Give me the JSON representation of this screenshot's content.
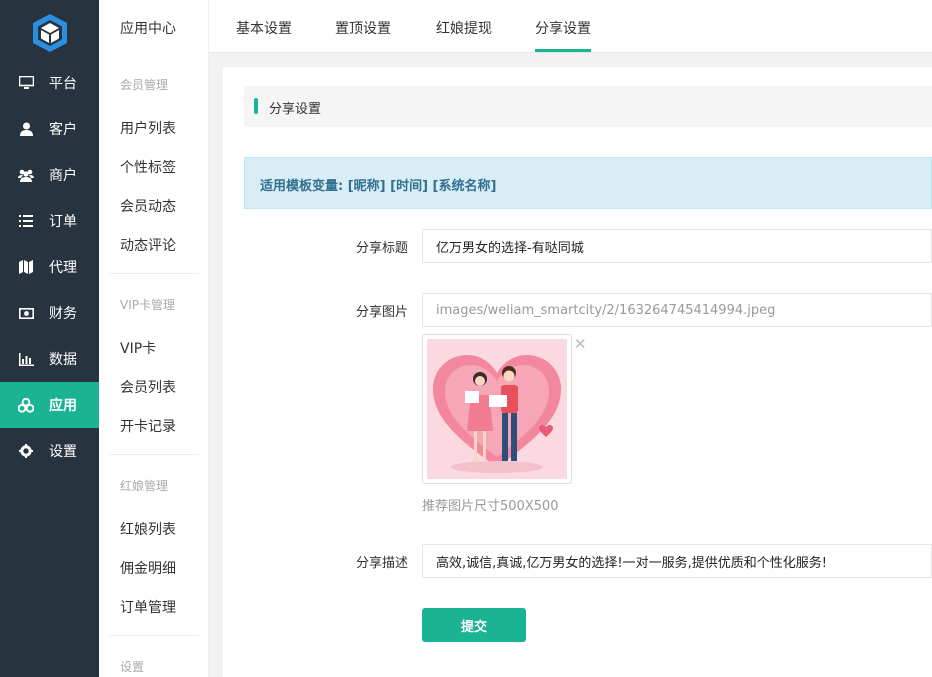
{
  "sidebar": {
    "logo": "app-logo",
    "items": [
      {
        "label": "平台",
        "icon": "monitor-icon"
      },
      {
        "label": "客户",
        "icon": "user-icon"
      },
      {
        "label": "商户",
        "icon": "users-icon"
      },
      {
        "label": "订单",
        "icon": "list-icon"
      },
      {
        "label": "代理",
        "icon": "map-icon"
      },
      {
        "label": "财务",
        "icon": "money-icon"
      },
      {
        "label": "数据",
        "icon": "bar-chart-icon"
      },
      {
        "label": "应用",
        "icon": "cubes-icon",
        "active": true
      },
      {
        "label": "设置",
        "icon": "gear-icon"
      }
    ]
  },
  "subnav": {
    "title": "应用中心",
    "groups": [
      {
        "title": "会员管理",
        "items": [
          "用户列表",
          "个性标签",
          "会员动态",
          "动态评论"
        ]
      },
      {
        "title": "VIP卡管理",
        "items": [
          "VIP卡",
          "会员列表",
          "开卡记录"
        ]
      },
      {
        "title": "红娘管理",
        "items": [
          "红娘列表",
          "佣金明细",
          "订单管理"
        ]
      },
      {
        "title": "设置",
        "items": []
      }
    ]
  },
  "tabs": [
    {
      "label": "基本设置"
    },
    {
      "label": "置顶设置"
    },
    {
      "label": "红娘提现"
    },
    {
      "label": "分享设置",
      "active": true
    }
  ],
  "main": {
    "section_title": "分享设置",
    "notice": "适用模板变量: [昵称] [时间] [系统名称]",
    "fields": {
      "title_label": "分享标题",
      "title_value": "亿万男女的选择-有哒同城",
      "image_label": "分享图片",
      "image_value": "images/weliam_smartcity/2/163264745414994.jpeg",
      "image_hint": "推荐图片尺寸500X500",
      "desc_label": "分享描述",
      "desc_value": "高效,诚信,真诚,亿万男女的选择!一对一服务,提供优质和个性化服务!"
    },
    "submit_label": "提交"
  },
  "colors": {
    "accent": "#1ab394",
    "sidebar_bg": "#283340",
    "notice_bg": "#d9edf7",
    "notice_text": "#31708f"
  }
}
